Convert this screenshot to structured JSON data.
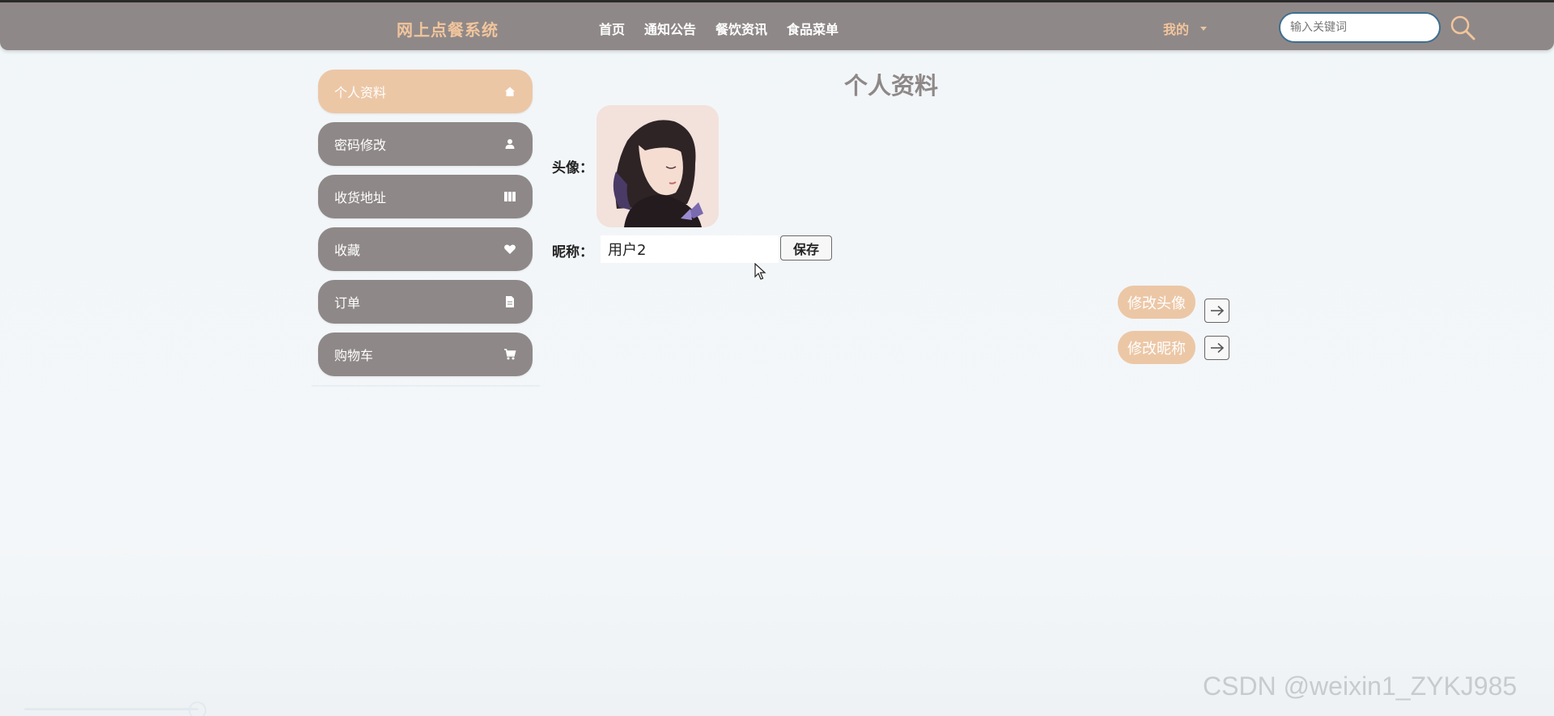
{
  "header": {
    "brand": "网上点餐系统",
    "nav": [
      "首页",
      "通知公告",
      "餐饮资讯",
      "食品菜单"
    ],
    "user_menu": "我的",
    "search_placeholder": "输入关键词"
  },
  "sidebar": {
    "items": [
      {
        "label": "个人资料",
        "icon": "home-icon",
        "active": true
      },
      {
        "label": "密码修改",
        "icon": "user-icon",
        "active": false
      },
      {
        "label": "收货地址",
        "icon": "book-icon",
        "active": false
      },
      {
        "label": "收藏",
        "icon": "heart-icon",
        "active": false
      },
      {
        "label": "订单",
        "icon": "file-icon",
        "active": false
      },
      {
        "label": "购物车",
        "icon": "cart-icon",
        "active": false
      }
    ]
  },
  "profile": {
    "title": "个人资料",
    "avatar_label": "头像：",
    "nickname_label": "昵称：",
    "nickname_value": "用户2",
    "save_label": "保存"
  },
  "quick_actions": {
    "change_avatar": "修改头像",
    "change_nickname": "修改昵称"
  },
  "watermark": "CSDN @weixin1_ZYKJ985",
  "colors": {
    "topbar": "#8f8888",
    "accent": "#ecc7a6",
    "brand": "#f1c59c",
    "page_title": "#8f8888"
  }
}
